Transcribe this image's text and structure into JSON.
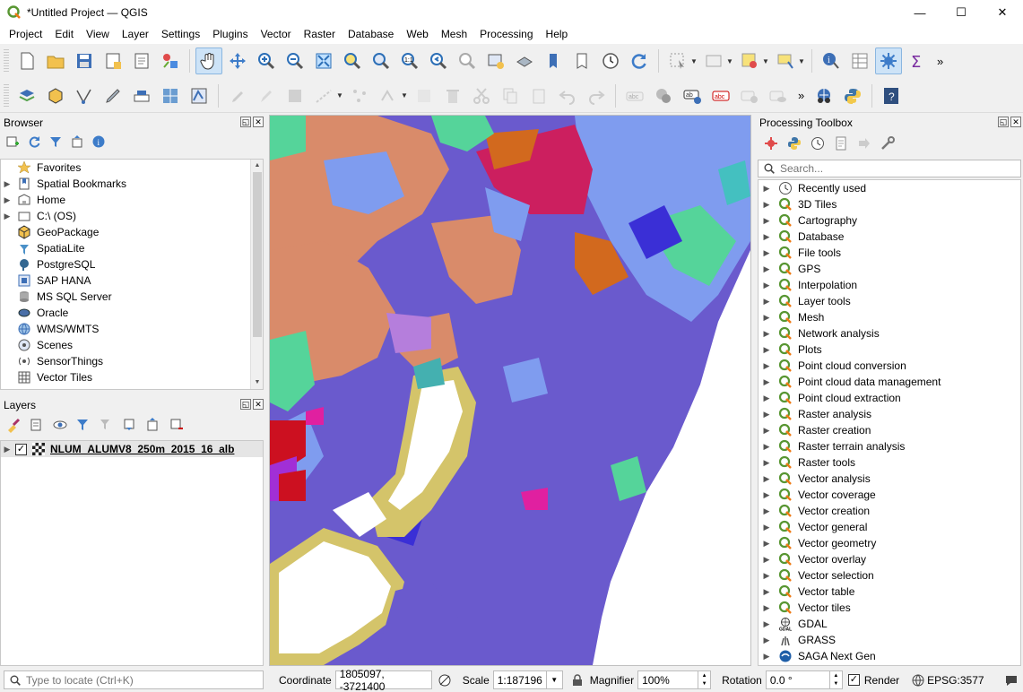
{
  "window": {
    "title": "*Untitled Project — QGIS",
    "minimize": "—",
    "maximize": "☐",
    "close": "✕"
  },
  "menu": [
    "Project",
    "Edit",
    "View",
    "Layer",
    "Settings",
    "Plugins",
    "Vector",
    "Raster",
    "Database",
    "Web",
    "Mesh",
    "Processing",
    "Help"
  ],
  "browser": {
    "title": "Browser",
    "items": [
      {
        "label": "Favorites",
        "icon": "star-icon",
        "expand": false
      },
      {
        "label": "Spatial Bookmarks",
        "icon": "bookmark-icon",
        "expand": true
      },
      {
        "label": "Home",
        "icon": "folder-icon",
        "expand": true
      },
      {
        "label": "C:\\ (OS)",
        "icon": "drive-icon",
        "expand": true
      },
      {
        "label": "GeoPackage",
        "icon": "geopackage-icon",
        "expand": false
      },
      {
        "label": "SpatiaLite",
        "icon": "spatialite-icon",
        "expand": false
      },
      {
        "label": "PostgreSQL",
        "icon": "postgresql-icon",
        "expand": false
      },
      {
        "label": "SAP HANA",
        "icon": "sap-hana-icon",
        "expand": false
      },
      {
        "label": "MS SQL Server",
        "icon": "mssql-icon",
        "expand": false
      },
      {
        "label": "Oracle",
        "icon": "oracle-icon",
        "expand": false
      },
      {
        "label": "WMS/WMTS",
        "icon": "wms-icon",
        "expand": false
      },
      {
        "label": "Scenes",
        "icon": "scenes-icon",
        "expand": false
      },
      {
        "label": "SensorThings",
        "icon": "sensorthings-icon",
        "expand": false
      },
      {
        "label": "Vector Tiles",
        "icon": "vector-tiles-icon",
        "expand": false
      }
    ]
  },
  "layers": {
    "title": "Layers",
    "items": [
      {
        "label": "NLUM_ALUMV8_250m_2015_16_alb",
        "checked": "✓"
      }
    ]
  },
  "processing": {
    "title": "Processing Toolbox",
    "search_placeholder": "Search...",
    "items": [
      {
        "label": "Recently used",
        "icon": "clock-icon"
      },
      {
        "label": "3D Tiles",
        "icon": "qgis-icon"
      },
      {
        "label": "Cartography",
        "icon": "qgis-icon"
      },
      {
        "label": "Database",
        "icon": "qgis-icon"
      },
      {
        "label": "File tools",
        "icon": "qgis-icon"
      },
      {
        "label": "GPS",
        "icon": "qgis-icon"
      },
      {
        "label": "Interpolation",
        "icon": "qgis-icon"
      },
      {
        "label": "Layer tools",
        "icon": "qgis-icon"
      },
      {
        "label": "Mesh",
        "icon": "qgis-icon"
      },
      {
        "label": "Network analysis",
        "icon": "qgis-icon"
      },
      {
        "label": "Plots",
        "icon": "qgis-icon"
      },
      {
        "label": "Point cloud conversion",
        "icon": "qgis-icon"
      },
      {
        "label": "Point cloud data management",
        "icon": "qgis-icon"
      },
      {
        "label": "Point cloud extraction",
        "icon": "qgis-icon"
      },
      {
        "label": "Raster analysis",
        "icon": "qgis-icon"
      },
      {
        "label": "Raster creation",
        "icon": "qgis-icon"
      },
      {
        "label": "Raster terrain analysis",
        "icon": "qgis-icon"
      },
      {
        "label": "Raster tools",
        "icon": "qgis-icon"
      },
      {
        "label": "Vector analysis",
        "icon": "qgis-icon"
      },
      {
        "label": "Vector coverage",
        "icon": "qgis-icon"
      },
      {
        "label": "Vector creation",
        "icon": "qgis-icon"
      },
      {
        "label": "Vector general",
        "icon": "qgis-icon"
      },
      {
        "label": "Vector geometry",
        "icon": "qgis-icon"
      },
      {
        "label": "Vector overlay",
        "icon": "qgis-icon"
      },
      {
        "label": "Vector selection",
        "icon": "qgis-icon"
      },
      {
        "label": "Vector table",
        "icon": "qgis-icon"
      },
      {
        "label": "Vector tiles",
        "icon": "qgis-icon"
      },
      {
        "label": "GDAL",
        "icon": "gdal-icon"
      },
      {
        "label": "GRASS",
        "icon": "grass-icon"
      },
      {
        "label": "SAGA Next Gen",
        "icon": "saga-icon"
      }
    ]
  },
  "status": {
    "locate_placeholder": "Type to locate (Ctrl+K)",
    "coordinate_label": "Coordinate",
    "coordinate_value": "1805097, -3721400",
    "scale_label": "Scale",
    "scale_value": "1:187196",
    "magnifier_label": "Magnifier",
    "magnifier_value": "100%",
    "rotation_label": "Rotation",
    "rotation_value": "0.0 °",
    "render_label": "Render",
    "render_checked": "✓",
    "crs": "EPSG:3577"
  },
  "colors": {
    "map_purple": "#6a5acd",
    "map_salmon": "#d98b6a",
    "map_lightblue": "#7f9cef",
    "map_green": "#55d49a",
    "map_crimson": "#cc1f5f",
    "map_orange": "#d2691e",
    "map_khaki": "#d4c46a"
  }
}
